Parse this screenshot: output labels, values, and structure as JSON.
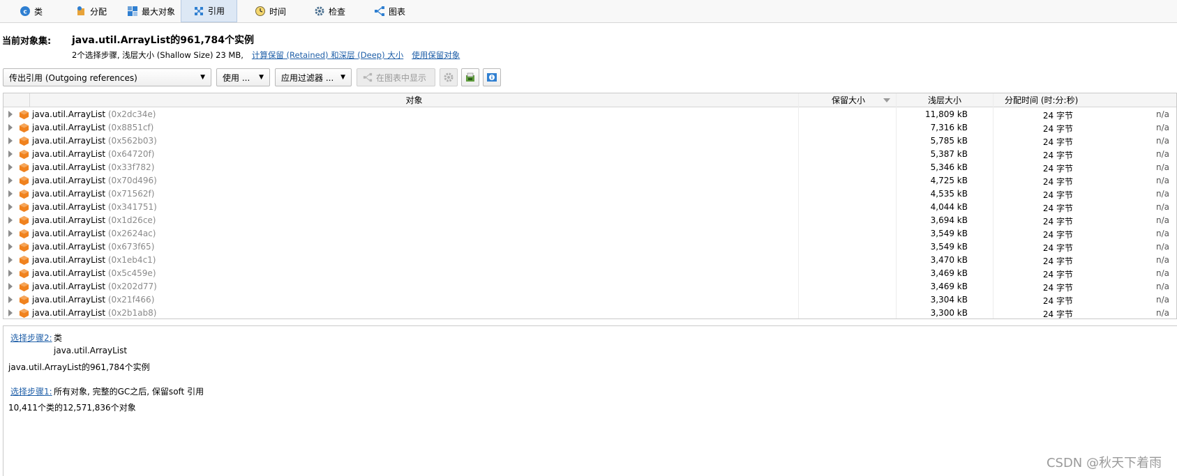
{
  "tabs": [
    {
      "label": "类",
      "icon": "class-icon"
    },
    {
      "label": "分配",
      "icon": "allocation-icon"
    },
    {
      "label": "最大对象",
      "icon": "biggest-objects-icon"
    },
    {
      "label": "引用",
      "icon": "references-icon",
      "active": true
    },
    {
      "label": "时间",
      "icon": "time-icon"
    },
    {
      "label": "检查",
      "icon": "inspect-icon"
    },
    {
      "label": "图表",
      "icon": "graph-icon"
    }
  ],
  "header": {
    "label": "当前对象集:",
    "title": "java.util.ArrayList的961,784个实例",
    "subtitle": "2个选择步骤, 浅层大小 (Shallow Size) 23 MB,",
    "link_compute": "计算保留 (Retained) 和深层 (Deep) 大小",
    "link_use_retained": "使用保留对象"
  },
  "toolbar": {
    "view_select": "传出引用 (Outgoing references)",
    "use_button": "使用 ...",
    "filter_button": "应用过滤器 ...",
    "show_in_graph": "在图表中显示"
  },
  "table": {
    "columns": [
      "对象",
      "保留大小",
      "浅层大小",
      "分配时间 (时:分:秒)"
    ],
    "rows": [
      {
        "name": "java.util.ArrayList",
        "addr": "(0x2dc34e)",
        "retained": "11,809 kB",
        "shallow": "24 字节",
        "alloc": "n/a"
      },
      {
        "name": "java.util.ArrayList",
        "addr": "(0x8851cf)",
        "retained": "7,316 kB",
        "shallow": "24 字节",
        "alloc": "n/a"
      },
      {
        "name": "java.util.ArrayList",
        "addr": "(0x562b03)",
        "retained": "5,785 kB",
        "shallow": "24 字节",
        "alloc": "n/a"
      },
      {
        "name": "java.util.ArrayList",
        "addr": "(0x64720f)",
        "retained": "5,387 kB",
        "shallow": "24 字节",
        "alloc": "n/a"
      },
      {
        "name": "java.util.ArrayList",
        "addr": "(0x33f782)",
        "retained": "5,346 kB",
        "shallow": "24 字节",
        "alloc": "n/a"
      },
      {
        "name": "java.util.ArrayList",
        "addr": "(0x70d496)",
        "retained": "4,725 kB",
        "shallow": "24 字节",
        "alloc": "n/a"
      },
      {
        "name": "java.util.ArrayList",
        "addr": "(0x71562f)",
        "retained": "4,535 kB",
        "shallow": "24 字节",
        "alloc": "n/a"
      },
      {
        "name": "java.util.ArrayList",
        "addr": "(0x341751)",
        "retained": "4,044 kB",
        "shallow": "24 字节",
        "alloc": "n/a"
      },
      {
        "name": "java.util.ArrayList",
        "addr": "(0x1d26ce)",
        "retained": "3,694 kB",
        "shallow": "24 字节",
        "alloc": "n/a"
      },
      {
        "name": "java.util.ArrayList",
        "addr": "(0x2624ac)",
        "retained": "3,549 kB",
        "shallow": "24 字节",
        "alloc": "n/a"
      },
      {
        "name": "java.util.ArrayList",
        "addr": "(0x673f65)",
        "retained": "3,549 kB",
        "shallow": "24 字节",
        "alloc": "n/a"
      },
      {
        "name": "java.util.ArrayList",
        "addr": "(0x1eb4c1)",
        "retained": "3,470 kB",
        "shallow": "24 字节",
        "alloc": "n/a"
      },
      {
        "name": "java.util.ArrayList",
        "addr": "(0x5c459e)",
        "retained": "3,469 kB",
        "shallow": "24 字节",
        "alloc": "n/a"
      },
      {
        "name": "java.util.ArrayList",
        "addr": "(0x202d77)",
        "retained": "3,469 kB",
        "shallow": "24 字节",
        "alloc": "n/a"
      },
      {
        "name": "java.util.ArrayList",
        "addr": "(0x21f466)",
        "retained": "3,304 kB",
        "shallow": "24 字节",
        "alloc": "n/a"
      },
      {
        "name": "java.util.ArrayList",
        "addr": "(0x2b1ab8)",
        "retained": "3,300 kB",
        "shallow": "24 字节",
        "alloc": "n/a"
      }
    ]
  },
  "steps": {
    "step2_link": "选择步骤2:",
    "step2_kind": "类",
    "step2_class": "java.util.ArrayList",
    "step2_result": "java.util.ArrayList的961,784个实例",
    "step1_link": "选择步骤1:",
    "step1_desc": "所有对象, 完整的GC之后, 保留soft 引用",
    "step1_result": "10,411个类的12,571,836个对象"
  },
  "watermark": "CSDN @秋天下着雨",
  "colors": {
    "accent": "#1f5fa8",
    "object_icon": "#f0821e",
    "active_tab": "#dde8f5"
  }
}
